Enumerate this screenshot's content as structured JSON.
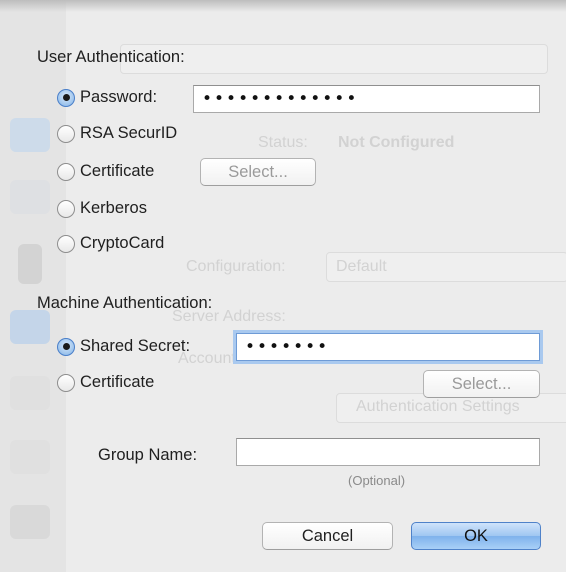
{
  "background": {
    "faded_texts": [
      "Status:",
      "Not Configured",
      "Configuration:",
      "Default",
      "Server Address:",
      "Account Name:",
      "Authentication Settings"
    ]
  },
  "user_auth": {
    "label": "User Authentication:",
    "options": [
      {
        "label": "Password:",
        "selected": true
      },
      {
        "label": "RSA SecurID",
        "selected": false
      },
      {
        "label": "Certificate",
        "selected": false
      },
      {
        "label": "Kerberos",
        "selected": false
      },
      {
        "label": "CryptoCard",
        "selected": false
      }
    ],
    "password_value": "•••••••••••••",
    "certificate_select_label": "Select..."
  },
  "machine_auth": {
    "label": "Machine Authentication:",
    "options": [
      {
        "label": "Shared Secret:",
        "selected": true
      },
      {
        "label": "Certificate",
        "selected": false
      }
    ],
    "shared_secret_value": "•••••••",
    "certificate_select_label": "Select..."
  },
  "group": {
    "label": "Group Name:",
    "value": "",
    "hint": "(Optional)"
  },
  "buttons": {
    "cancel": "Cancel",
    "ok": "OK"
  }
}
